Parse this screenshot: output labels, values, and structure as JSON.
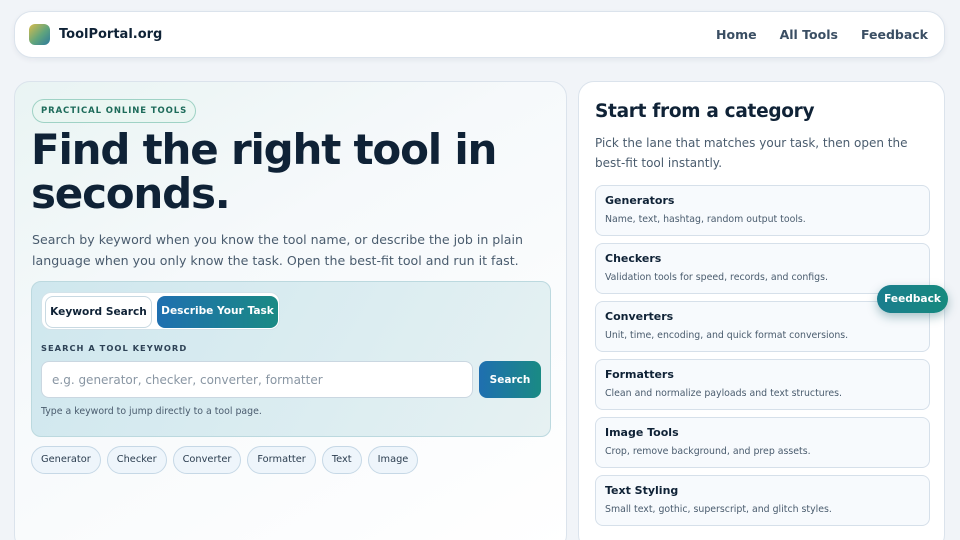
{
  "header": {
    "brand": "ToolPortal.org",
    "nav": [
      "Home",
      "All Tools",
      "Feedback"
    ]
  },
  "hero": {
    "eyebrow": "PRACTICAL ONLINE TOOLS",
    "headline": "Find the right tool in seconds.",
    "lede": "Search by keyword when you know the tool name, or describe the job in plain language when you only know the task. Open the best-fit tool and run it fast."
  },
  "search": {
    "tabs": [
      "Keyword Search",
      "Describe Your Task"
    ],
    "active_tab": "Describe Your Task",
    "field_label": "SEARCH A TOOL KEYWORD",
    "placeholder": "e.g. generator, checker, converter, formatter",
    "value": "",
    "button": "Search",
    "hint": "Type a keyword to jump directly to a tool page."
  },
  "chips": [
    "Generator",
    "Checker",
    "Converter",
    "Formatter",
    "Text",
    "Image"
  ],
  "categories": {
    "title": "Start from a category",
    "subtitle": "Pick the lane that matches your task, then open the best-fit tool instantly.",
    "items": [
      {
        "name": "Generators",
        "desc": "Name, text, hashtag, random output tools."
      },
      {
        "name": "Checkers",
        "desc": "Validation tools for speed, records, and configs."
      },
      {
        "name": "Converters",
        "desc": "Unit, time, encoding, and quick format conversions."
      },
      {
        "name": "Formatters",
        "desc": "Clean and normalize payloads and text structures."
      },
      {
        "name": "Image Tools",
        "desc": "Crop, remove background, and prep assets."
      },
      {
        "name": "Text Styling",
        "desc": "Small text, gothic, superscript, and glitch styles."
      }
    ]
  },
  "feedback_fab": "Feedback",
  "colors": {
    "accent_blue": "#1f6fb0",
    "accent_teal": "#1a8a84",
    "text_dark": "#0f2236"
  }
}
